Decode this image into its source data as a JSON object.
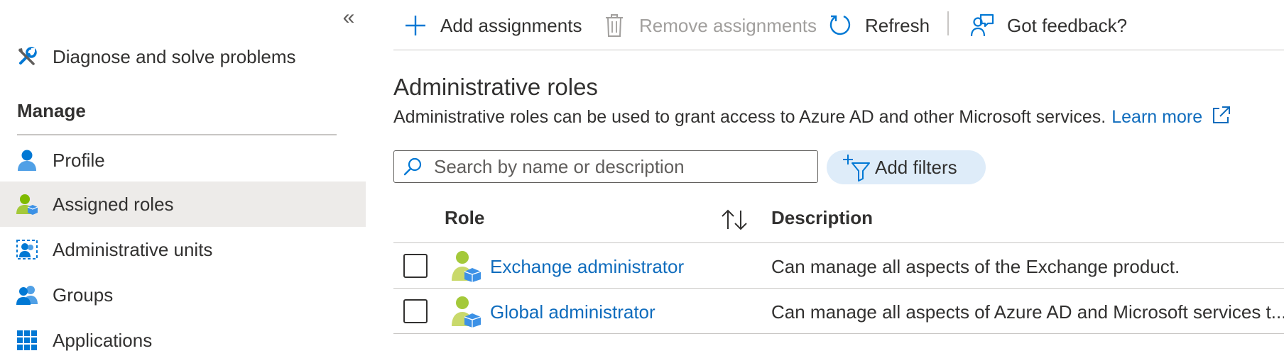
{
  "sidebar": {
    "collapse_glyph": "«",
    "top_item": {
      "label": "Diagnose and solve problems",
      "icon": "wrench-screwdriver-icon"
    },
    "section_label": "Manage",
    "items": [
      {
        "label": "Profile",
        "icon": "profile-icon",
        "selected": false
      },
      {
        "label": "Assigned roles",
        "icon": "assigned-roles-icon",
        "selected": true
      },
      {
        "label": "Administrative units",
        "icon": "administrative-units-icon",
        "selected": false
      },
      {
        "label": "Groups",
        "icon": "groups-icon",
        "selected": false
      },
      {
        "label": "Applications",
        "icon": "applications-icon",
        "selected": false
      }
    ]
  },
  "toolbar": {
    "add_label": "Add assignments",
    "remove_label": "Remove assignments",
    "refresh_label": "Refresh",
    "feedback_label": "Got feedback?"
  },
  "content": {
    "title": "Administrative roles",
    "description": "Administrative roles can be used to grant access to Azure AD and other Microsoft services.",
    "learn_more": "Learn more",
    "search_placeholder": "Search by name or description",
    "filter_label": "Add filters"
  },
  "table": {
    "columns": [
      "Role",
      "Description"
    ],
    "rows": [
      {
        "role": "Exchange administrator",
        "description": "Can manage all aspects of the Exchange product.",
        "checked": false
      },
      {
        "role": "Global administrator",
        "description": "Can manage all aspects of Azure AD and Microsoft services t...",
        "checked": false
      }
    ]
  },
  "colors": {
    "accent": "#0f6cbd",
    "selected_nav_bg": "#edebe9",
    "filter_pill_bg": "#deecf9",
    "disabled_text": "#a19f9d"
  }
}
